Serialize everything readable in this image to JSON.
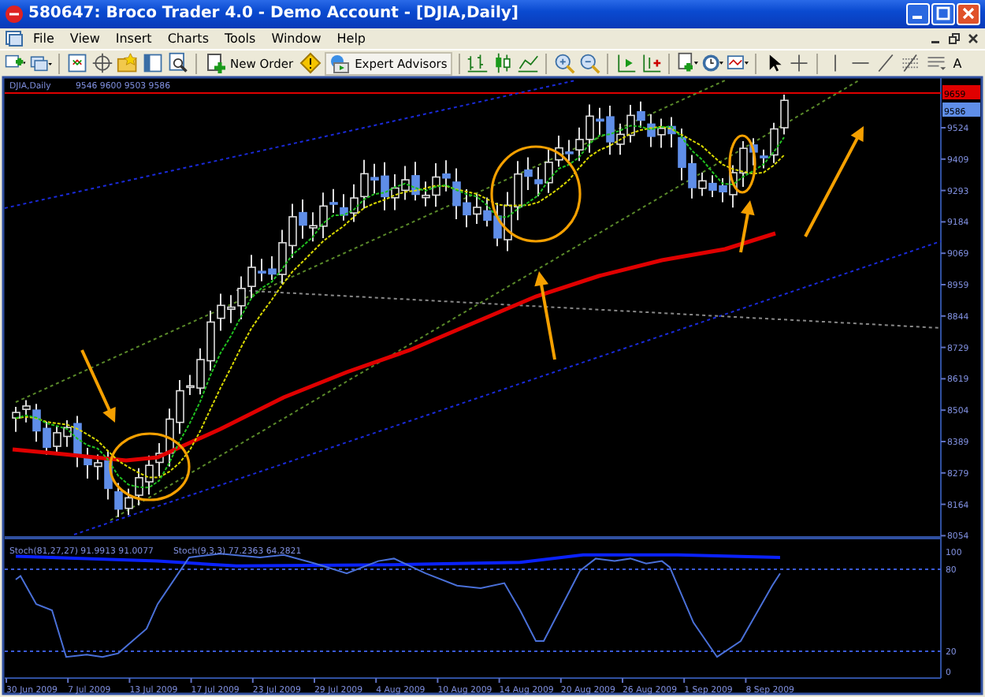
{
  "window": {
    "title": "580647: Broco Trader 4.0 - Demo Account - [DJIA,Daily]"
  },
  "menu": [
    "File",
    "View",
    "Insert",
    "Charts",
    "Tools",
    "Window",
    "Help"
  ],
  "toolbar": {
    "new_order": "New Order",
    "expert_advisors": "Expert Advisors",
    "text_tool": "A"
  },
  "chart": {
    "symbol": "DJIA,Daily",
    "ohlc": "9546 9600 9503 9586",
    "alert_price": "9659",
    "current_price": "9586",
    "price_labels": [
      "9524",
      "9409",
      "9293",
      "9184",
      "9069",
      "8959",
      "8844",
      "8729",
      "8619",
      "8504",
      "8389",
      "8279",
      "8164",
      "8054"
    ],
    "indicator_name_1": "Stoch(81,27,27) 91.9913 91.0077",
    "indicator_name_2": "Stoch(9,3,3) 77.2363 64.2821",
    "indicator_labels": [
      "100",
      "80",
      "20",
      "0"
    ],
    "dates": [
      "30 Jun 2009",
      "7 Jul 2009",
      "13 Jul 2009",
      "17 Jul 2009",
      "23 Jul 2009",
      "29 Jul 2009",
      "4 Aug 2009",
      "10 Aug 2009",
      "14 Aug 2009",
      "20 Aug 2009",
      "26 Aug 2009",
      "1 Sep 2009",
      "8 Sep 2009"
    ]
  }
}
